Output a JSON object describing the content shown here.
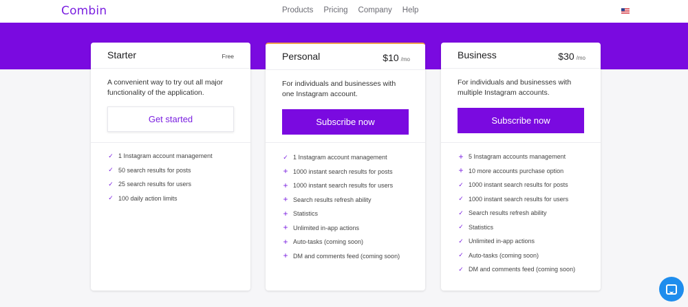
{
  "header": {
    "logo": "Combin",
    "nav": [
      "Products",
      "Pricing",
      "Company",
      "Help"
    ],
    "flag_icon": "us-flag-icon"
  },
  "colors": {
    "brand": "#7a0ae0",
    "accent_orange": "#f0a24a",
    "chat_blue": "#1f8ded"
  },
  "plans": {
    "starter": {
      "name": "Starter",
      "price_label": "Free",
      "description": "A convenient way to try out all major functionality of the application.",
      "button": "Get started",
      "features": [
        {
          "icon": "check",
          "text": "1 Instagram account management"
        },
        {
          "icon": "check",
          "text": "50 search results for posts"
        },
        {
          "icon": "check",
          "text": "25 search results for users"
        },
        {
          "icon": "check",
          "text": "100 daily action limits"
        }
      ]
    },
    "personal": {
      "name": "Personal",
      "price": "$10",
      "per": "/mo",
      "description": "For individuals and businesses with one Instagram account.",
      "button": "Subscribe now",
      "features": [
        {
          "icon": "check",
          "text": "1 Instagram account management"
        },
        {
          "icon": "plus",
          "text": "1000 instant search results for posts"
        },
        {
          "icon": "plus",
          "text": "1000 instant search results for users"
        },
        {
          "icon": "plus",
          "text": "Search results refresh ability"
        },
        {
          "icon": "plus",
          "text": "Statistics"
        },
        {
          "icon": "plus",
          "text": "Unlimited in-app actions"
        },
        {
          "icon": "plus",
          "text": "Auto-tasks (coming soon)"
        },
        {
          "icon": "plus",
          "text": "DM and comments feed (coming soon)"
        }
      ]
    },
    "business": {
      "name": "Business",
      "price": "$30",
      "per": "/mo",
      "description": "For individuals and businesses with multiple Instagram accounts.",
      "button": "Subscribe now",
      "features": [
        {
          "icon": "plus",
          "text": "5 Instagram accounts management"
        },
        {
          "icon": "plus",
          "text": "10 more accounts purchase option"
        },
        {
          "icon": "check",
          "text": "1000 instant search results for posts"
        },
        {
          "icon": "check",
          "text": "1000 instant search results for users"
        },
        {
          "icon": "check",
          "text": "Search results refresh ability"
        },
        {
          "icon": "check",
          "text": "Statistics"
        },
        {
          "icon": "check",
          "text": "Unlimited in-app actions"
        },
        {
          "icon": "check",
          "text": "Auto-tasks (coming soon)"
        },
        {
          "icon": "check",
          "text": "DM and comments feed (coming soon)"
        }
      ]
    }
  },
  "chat_widget_icon": "chat-bubble-icon"
}
